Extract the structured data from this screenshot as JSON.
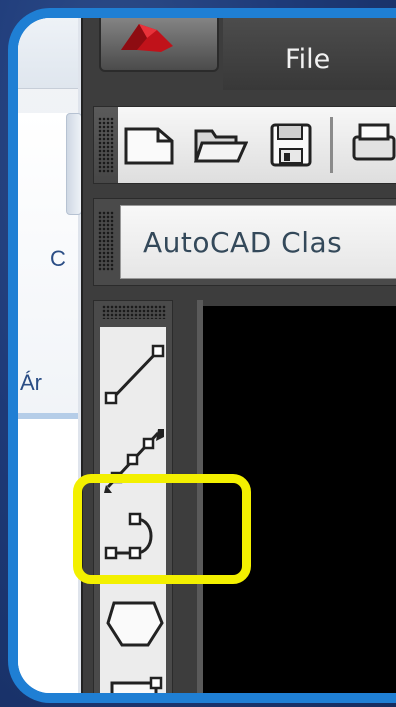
{
  "background_window": {
    "letters": [
      "C",
      "Ár"
    ]
  },
  "app": {
    "menu": {
      "file_label": "File"
    },
    "workspace": {
      "value": "AutoCAD Clas"
    },
    "toolbar": {
      "icons": [
        "new-icon",
        "open-icon",
        "save-icon",
        "print-icon"
      ]
    },
    "draw_toolbar": {
      "tools": [
        "line-icon",
        "construction-line-icon",
        "polyline-icon",
        "polygon-icon",
        "rectangle-icon"
      ]
    }
  },
  "colors": {
    "highlight": "#f3f000",
    "frame": "#1f7fd4",
    "canvas": "#000000"
  }
}
